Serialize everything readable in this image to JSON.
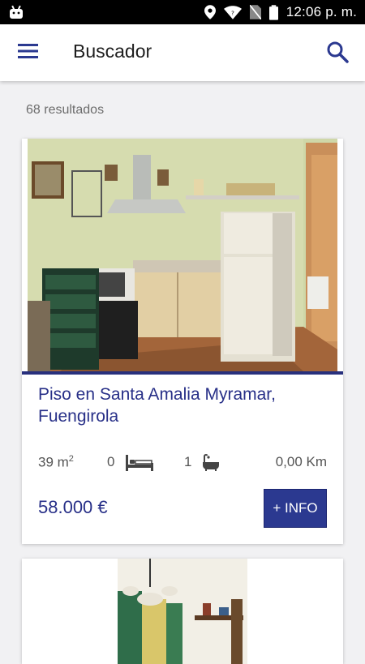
{
  "status_bar": {
    "time": "12:06 p. m.",
    "icons": [
      "android-icon",
      "location-icon",
      "wifi-icon",
      "no-sim-icon",
      "battery-icon"
    ]
  },
  "app_bar": {
    "title": "Buscador",
    "menu_icon": "hamburger-menu-icon",
    "search_icon": "search-icon"
  },
  "results": {
    "count_text": "68 resultados"
  },
  "listings": [
    {
      "title": "Piso en Santa Amalia Myramar, Fuengirola",
      "area_value": "39 m",
      "area_unit_sup": "2",
      "bedrooms": "0",
      "bathrooms": "1",
      "distance": "0,00 Km",
      "price": "58.000 €",
      "button_label": "+ INFO"
    }
  ],
  "colors": {
    "primary": "#283088",
    "button": "#2b3990",
    "background": "#f1f1f3"
  }
}
